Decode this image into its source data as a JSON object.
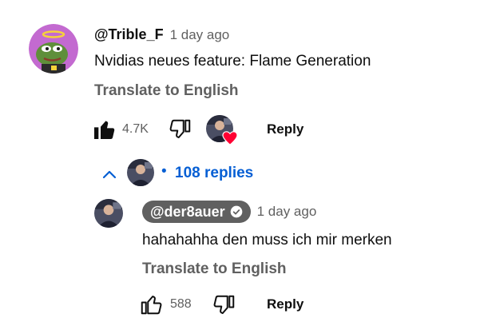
{
  "comment": {
    "author": "@Trible_F",
    "time": "1 day ago",
    "text": "Nvidias neues feature: Flame Generation",
    "translate": "Translate to English",
    "likes": "4.7K",
    "reply_label": "Reply",
    "replies_label": "108 replies",
    "icons": {
      "like": "thumbs-up-filled-icon",
      "dislike": "thumbs-down-outline-icon",
      "creator_heart": "creator-heart-icon",
      "collapse": "chevron-up-icon"
    }
  },
  "reply": {
    "author": "@der8auer",
    "time": "1 day ago",
    "text": "hahahahha den muss ich mir merken",
    "translate": "Translate to English",
    "likes": "588",
    "reply_label": "Reply",
    "icons": {
      "verified": "verified-check-icon",
      "like": "thumbs-up-outline-icon",
      "dislike": "thumbs-down-outline-icon"
    }
  },
  "colors": {
    "link_blue": "#065fd4",
    "secondary_text": "#606060",
    "heart_red": "#ff0033",
    "pill_bg": "#606060"
  }
}
